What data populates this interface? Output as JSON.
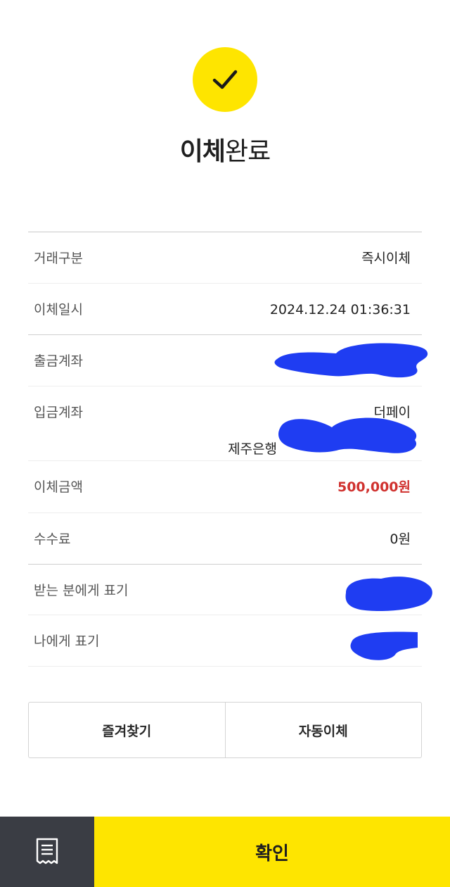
{
  "header": {
    "title_bold": "이체",
    "title_rest": "완료"
  },
  "colors": {
    "accent_yellow": "#fee500",
    "amount_red": "#d0322f",
    "bottom_dark": "#3a3d44",
    "redaction_blue": "#1f3df2"
  },
  "icons": {
    "success": "checkmark-icon",
    "receipt": "receipt-icon"
  },
  "details": {
    "transaction_type": {
      "label": "거래구분",
      "value": "즉시이체"
    },
    "transfer_datetime": {
      "label": "이체일시",
      "value": "2024.12.24 01:36:31"
    },
    "from_account": {
      "label": "출금계좌",
      "value": ""
    },
    "to_account": {
      "label": "입금계좌",
      "value": "더페이",
      "bank": "제주은행"
    },
    "amount": {
      "label": "이체금액",
      "value": "500,000원"
    },
    "fee": {
      "label": "수수료",
      "value": "0원"
    },
    "recipient_memo": {
      "label": "받는 분에게 표기",
      "value": ""
    },
    "my_memo": {
      "label": "나에게 표기",
      "value": ""
    }
  },
  "actions": {
    "favorite_label": "즐겨찾기",
    "auto_transfer_label": "자동이체",
    "confirm_label": "확인"
  }
}
